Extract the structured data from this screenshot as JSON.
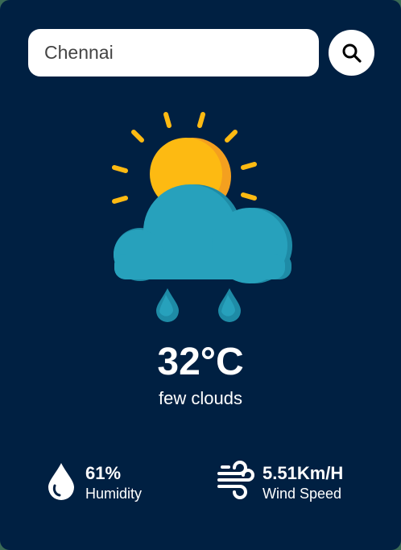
{
  "search": {
    "value": "Chennai"
  },
  "weather": {
    "icon": "sun-cloud-rain-icon",
    "temperature": "32°C",
    "condition": "few clouds"
  },
  "humidity": {
    "value": "61%",
    "label": "Humidity",
    "icon": "water-drop-icon"
  },
  "wind": {
    "value": "5.51Km/H",
    "label": "Wind Speed",
    "icon": "wind-icon"
  },
  "colors": {
    "background": "#002042",
    "sun": "#FDBA12",
    "sun_shade": "#F4A01F",
    "cloud": "#27A1BC",
    "cloud_shade": "#1E8BA6",
    "text": "#FFFFFF"
  }
}
